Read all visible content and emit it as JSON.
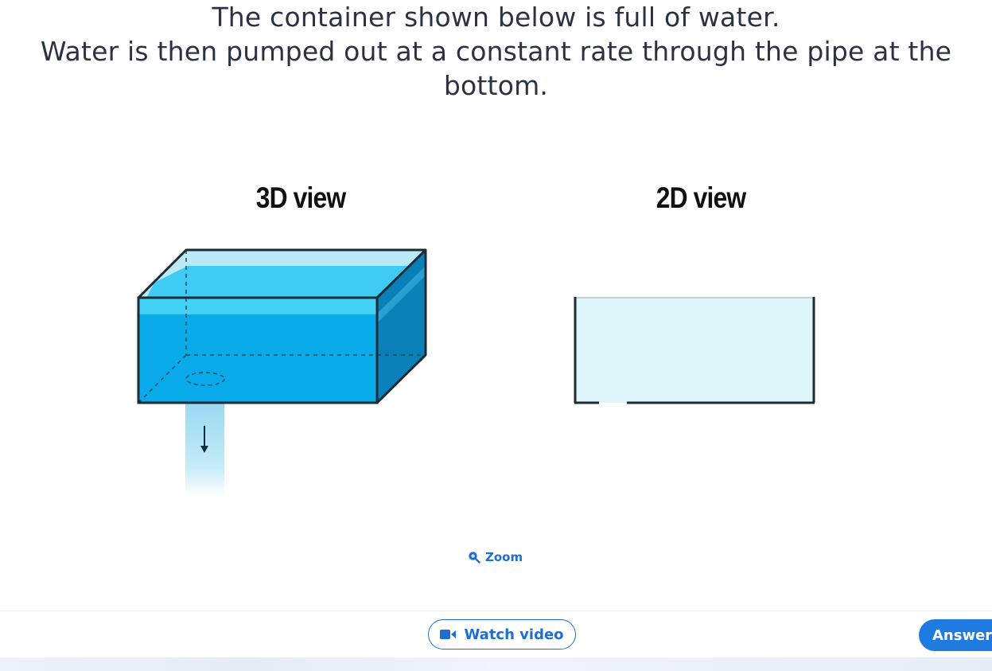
{
  "question": {
    "line1": "The container shown below is full of water.",
    "line2": "Water is then pumped out at a constant rate through the pipe at the",
    "line3": "bottom."
  },
  "views": {
    "view3d_title": "3D view",
    "view2d_title": "2D view"
  },
  "icons": {
    "down_arrow": "down-arrow-icon",
    "zoom": "zoom-in-icon",
    "video": "video-camera-icon"
  },
  "zoom_label": "Zoom",
  "footer": {
    "watch_video_label": "Watch video",
    "answer_label": "Answer"
  },
  "colors": {
    "water_front": "#09aae9",
    "water_top": "#42cdf4",
    "water_side": "#0a82bd",
    "water_2d": "#dff6fb",
    "outline": "#1d2b36",
    "accent": "#1f6fd1"
  }
}
